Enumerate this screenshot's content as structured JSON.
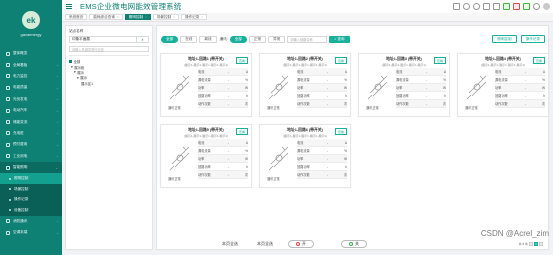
{
  "app": {
    "title": "EMS企业微电网能效管理系统",
    "logo_caption": "gavaenergy",
    "logo_letter": "ek"
  },
  "sidebar": {
    "items": [
      {
        "label": "整体概览"
      },
      {
        "label": "全局看板"
      },
      {
        "label": "电力监控"
      },
      {
        "label": "电能质量"
      },
      {
        "label": "光伏发电"
      },
      {
        "label": "电动汽车"
      },
      {
        "label": "储能变流"
      },
      {
        "label": "充电桩"
      },
      {
        "label": "预付费用"
      },
      {
        "label": "工业用电"
      },
      {
        "label": "智能照明"
      }
    ],
    "subitems": [
      {
        "label": "照明控制"
      },
      {
        "label": "场景控制"
      },
      {
        "label": "操作记录"
      },
      {
        "label": "设备控制"
      }
    ],
    "bottom_items": [
      {
        "label": "消防通讯"
      },
      {
        "label": "空调末端"
      }
    ]
  },
  "tabs": [
    {
      "label": "系统首页"
    },
    {
      "label": "能耗综合查询"
    },
    {
      "label": "照明控制"
    },
    {
      "label": "场景控制"
    },
    {
      "label": "操作记录"
    }
  ],
  "tree": {
    "label": "站点名称",
    "selected": "印象平面展",
    "search_placeholder": "请输入关键字进行过滤",
    "nodes": [
      {
        "label": "全部"
      },
      {
        "label": "展示柜"
      },
      {
        "label": "展示"
      },
      {
        "label": "展示"
      },
      {
        "label": "展示区1"
      }
    ]
  },
  "filter": {
    "status_buttons": [
      "全部",
      "在线",
      "离线"
    ],
    "state_label": "通讯:",
    "state_buttons": [
      "全部",
      "正常",
      "异常"
    ],
    "input_placeholder": "请输入回路名称",
    "query_label": "查询",
    "right_buttons": [
      "照明控制",
      "操作记录"
    ]
  },
  "cards": [
    {
      "title": "地址1-回路1 (带开关)",
      "sub": "(展示1-展示1-展示1-展示1-展示1)",
      "btn": "查看"
    },
    {
      "title": "地址1-回路2 (带开关)",
      "sub": "(展示1-展示1-展示1-展示1-展示1)",
      "btn": "查看"
    },
    {
      "title": "地址1-回路3 (带开关)",
      "sub": "(展示1-展示1-展示1-展示1-展示1)",
      "btn": "查看"
    },
    {
      "title": "地址1-回路4 (带开关)",
      "sub": "(展示1-展示1-展示1-展示1-展示1)",
      "btn": "查看"
    },
    {
      "title": "地址1-回路5 (带开关)",
      "sub": "(展示1-展示1-展示1-展示1-展示1)",
      "btn": "查看"
    },
    {
      "title": "地址1-回路6 (带开关)",
      "sub": "(展示1-展示1-展示1-展示1-展示1)",
      "btn": "查看"
    }
  ],
  "card_rows": [
    {
      "k": "电流",
      "v": "-",
      "u": "A"
    },
    {
      "k": "漏电流量",
      "v": "-",
      "u": "%"
    },
    {
      "k": "功率",
      "v": "-",
      "u": "W"
    },
    {
      "k": "回路功率",
      "v": "-",
      "u": "h"
    },
    {
      "k": "动作次数",
      "v": "-",
      "u": "次"
    }
  ],
  "meter_label": "通讯正常",
  "bottom": {
    "select_all_page": "本页全选",
    "select_all": "本页全选",
    "on_label": "开",
    "off_label": "关",
    "pager_total": "共 8 条",
    "pages": [
      "<",
      "1",
      ">"
    ]
  },
  "watermark": "CSDN @Acrel_zim"
}
